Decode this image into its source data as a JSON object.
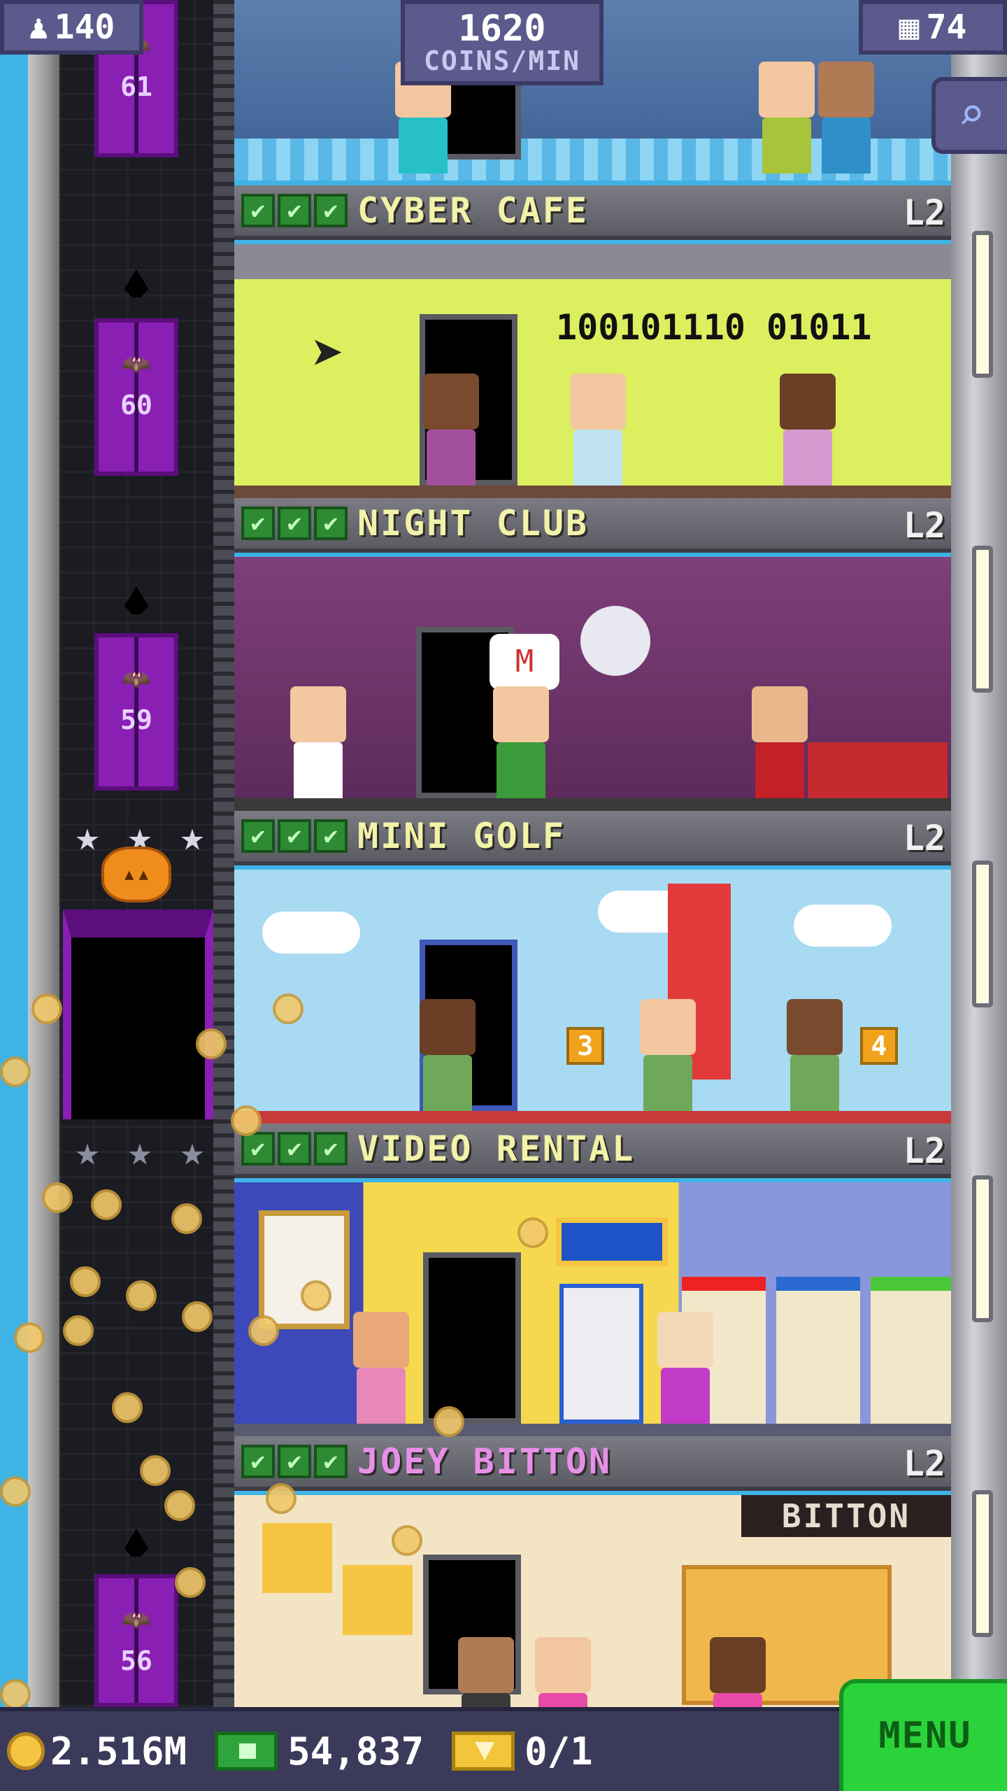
{
  "hud": {
    "population": "140",
    "coins_per_min_value": "1620",
    "coins_per_min_label": "COINS/MIN",
    "floors": "74"
  },
  "elevator": {
    "floors": [
      "61",
      "60",
      "59",
      "56"
    ]
  },
  "floors": [
    {
      "name": "CYBER CAFE",
      "level": "L2",
      "sign": "100101110  01011"
    },
    {
      "name": "NIGHT CLUB",
      "level": "L2"
    },
    {
      "name": "MINI GOLF",
      "level": "L2",
      "hole_a": "3",
      "hole_b": "4"
    },
    {
      "name": "VIDEO RENTAL",
      "level": "L2"
    },
    {
      "name": "JOEY BITTON",
      "level": "L2",
      "sign": "BITTON"
    }
  ],
  "bottom_bar": {
    "coins": "2.516M",
    "bux": "54,837",
    "tickets": "0/1",
    "menu_label": "MENU"
  },
  "colors": {
    "hud_bg": "#5c5a8c",
    "menu_green": "#2bd33b",
    "elevator_purple": "#8a1fb3"
  }
}
